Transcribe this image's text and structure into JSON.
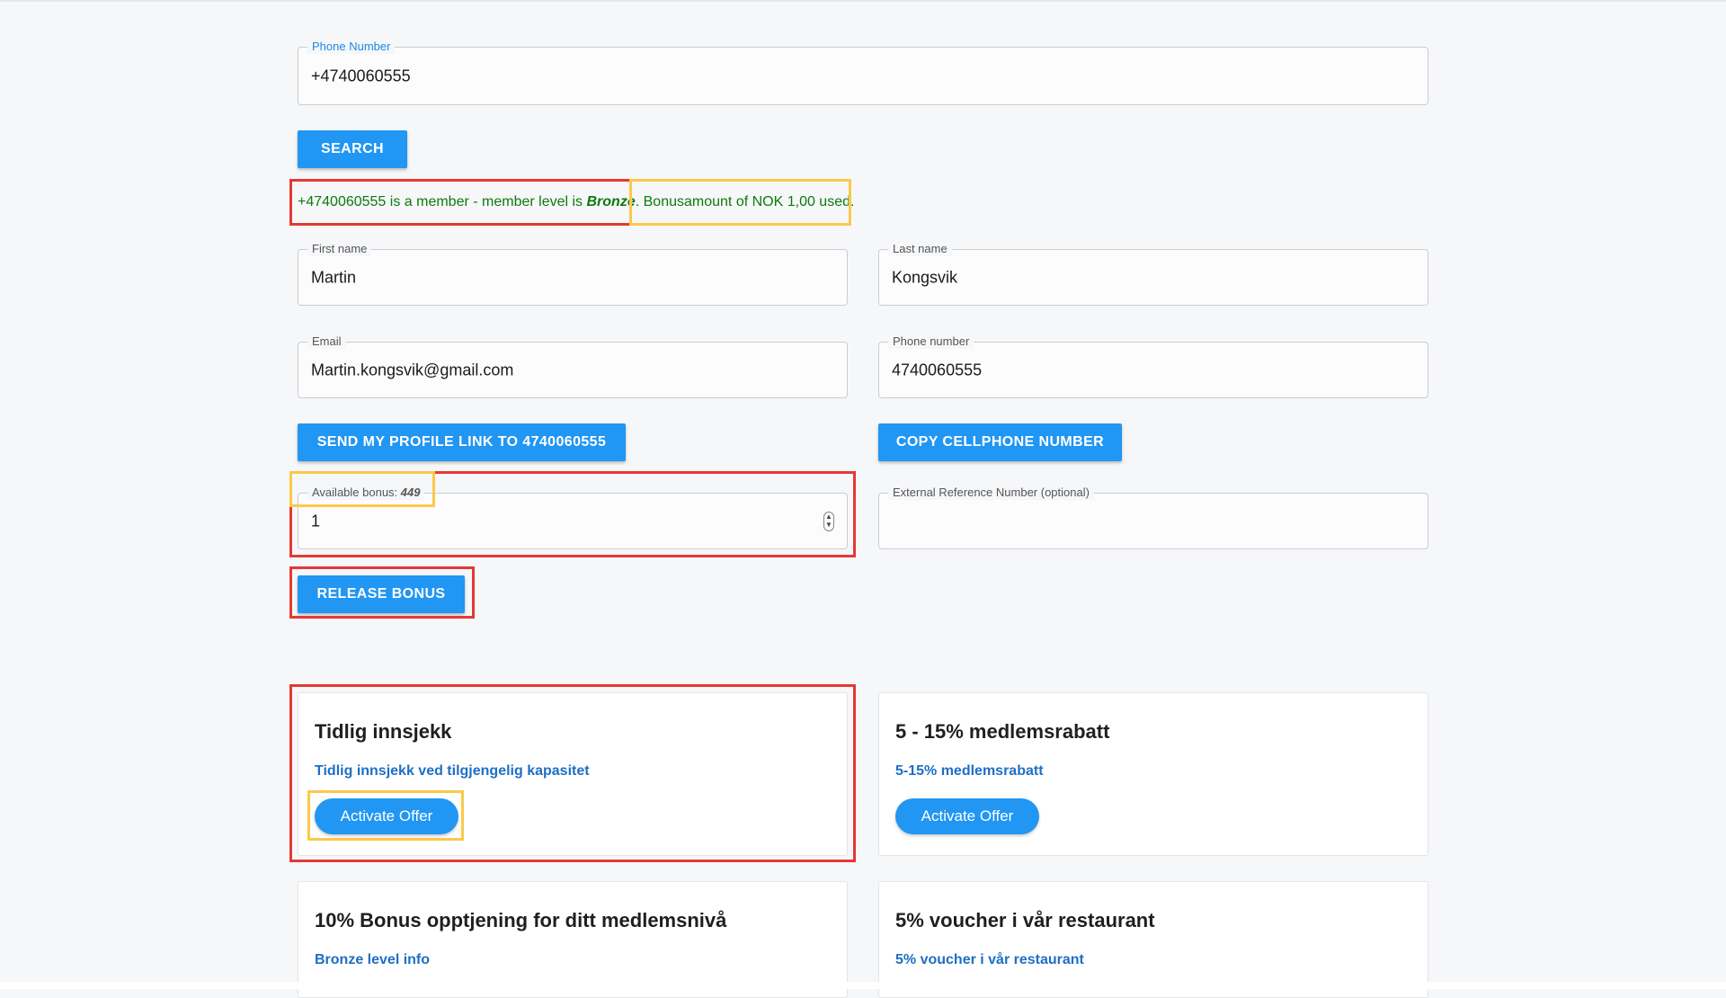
{
  "search": {
    "phone_label": "Phone Number",
    "phone_value": "+4740060555",
    "search_button": "SEARCH"
  },
  "status": {
    "member_text": "+4740060555 is a member - member level is ",
    "member_level": "Bronze",
    "member_suffix": ".",
    "bonus_used": " Bonusamount of NOK 1,00 used."
  },
  "profile": {
    "first_name_label": "First name",
    "first_name": "Martin",
    "last_name_label": "Last name",
    "last_name": "Kongsvik",
    "email_label": "Email",
    "email": "Martin.kongsvik@gmail.com",
    "phone_label": "Phone number",
    "phone": "4740060555",
    "send_link_button": "SEND MY PROFILE LINK TO 4740060555",
    "copy_phone_button": "COPY CELLPHONE NUMBER"
  },
  "bonus": {
    "available_label": "Available bonus: ",
    "available_amount": "449",
    "amount_value": "1",
    "external_ref_label": "External Reference Number (optional)",
    "external_ref_value": "",
    "release_button": "RELEASE BONUS"
  },
  "offers": [
    {
      "title": "Tidlig innsjekk",
      "link": "Tidlig innsjekk ved tilgjengelig kapasitet",
      "button": "Activate Offer"
    },
    {
      "title": "5 - 15% medlemsrabatt",
      "link": "5-15% medlemsrabatt",
      "button": "Activate Offer"
    },
    {
      "title": "10% Bonus opptjening for ditt medlemsnivå",
      "link": "Bronze level info"
    },
    {
      "title": "5% voucher i vår restaurant",
      "link": "5% voucher i vår restaurant"
    }
  ],
  "icons": {
    "stepper": "stepper-arrows-icon"
  },
  "colors": {
    "primary": "#2196f3",
    "success_text": "#0d7a0d",
    "highlight_red": "#e53935",
    "highlight_yellow": "#fbc94a",
    "link": "#1e6fc4"
  }
}
